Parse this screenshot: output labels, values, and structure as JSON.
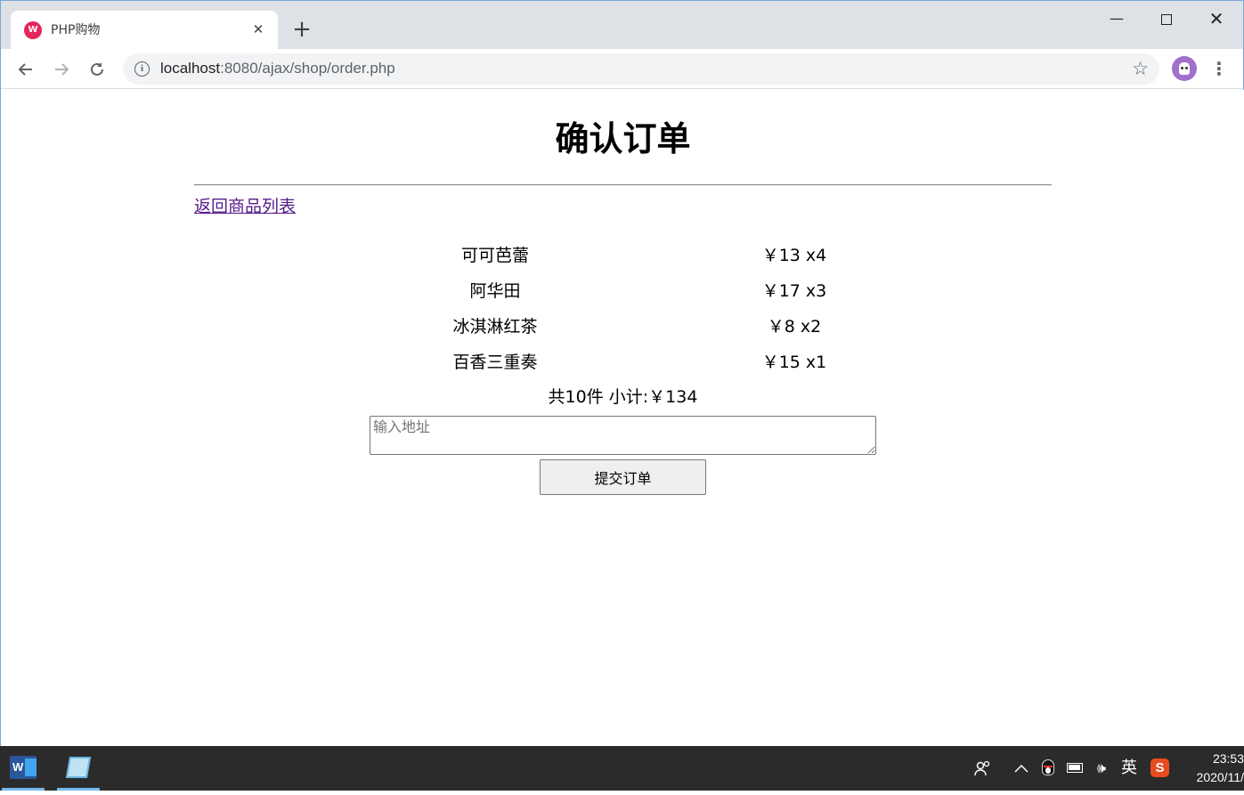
{
  "browser": {
    "tab_title": "PHP购物",
    "tab_favicon": "W",
    "tab_close": "✕",
    "new_tab": "+",
    "url_host": "localhost",
    "url_rest": ":8080/ajax/shop/order.php",
    "icons": {
      "back": "arrow-left",
      "forward": "arrow-right",
      "reload": "reload",
      "info": "info",
      "bookmark": "star",
      "menu": "more-vertical"
    },
    "accent": "#a16fcc"
  },
  "page": {
    "title": "确认订单",
    "back_link": "返回商品列表",
    "items": [
      {
        "name": "可可芭蕾",
        "price": "￥13 x4"
      },
      {
        "name": "阿华田",
        "price": "￥17 x3"
      },
      {
        "name": "冰淇淋红茶",
        "price": "￥8 x2"
      },
      {
        "name": "百香三重奏",
        "price": "￥15 x1"
      }
    ],
    "summary": "共10件 小计:￥134",
    "address_placeholder": "输入地址",
    "address_value": "",
    "submit_label": "提交订单",
    "link_color": "#551a8b"
  },
  "taskbar": {
    "apps": [
      "word",
      "notes"
    ],
    "word_letter": "W",
    "ime_label": "英",
    "sogou_label": "S",
    "time": "23:53",
    "date": "2020/11/"
  }
}
